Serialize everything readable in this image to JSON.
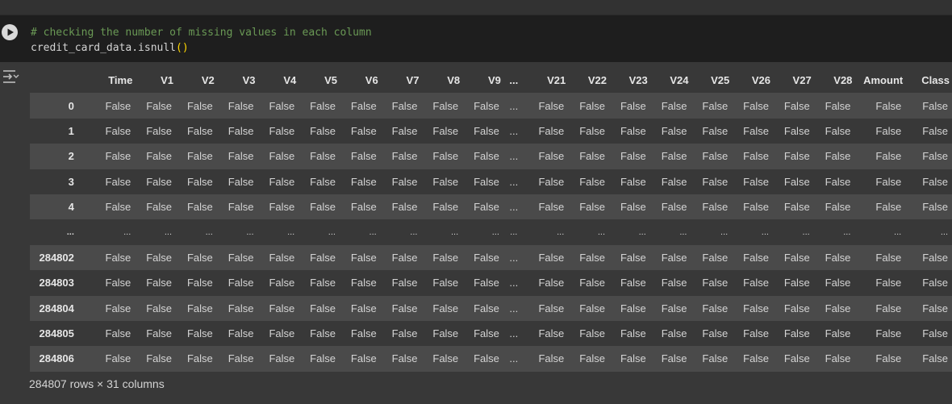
{
  "code_cell": {
    "comment": "# checking the number of missing values in each column",
    "code_prefix": "credit_card_data.isnull",
    "code_parens": "()"
  },
  "icons": {
    "run": "play-circle-icon",
    "output_toggle": "output-toggle-icon"
  },
  "table": {
    "header_index": "",
    "headers": [
      "Time",
      "V1",
      "V2",
      "V3",
      "V4",
      "V5",
      "V6",
      "V7",
      "V8",
      "V9",
      "...",
      "V21",
      "V22",
      "V23",
      "V24",
      "V25",
      "V26",
      "V27",
      "V28",
      "Amount",
      "Class"
    ],
    "rows": [
      {
        "index": "0",
        "cells": [
          "False",
          "False",
          "False",
          "False",
          "False",
          "False",
          "False",
          "False",
          "False",
          "False",
          "...",
          "False",
          "False",
          "False",
          "False",
          "False",
          "False",
          "False",
          "False",
          "False",
          "False"
        ]
      },
      {
        "index": "1",
        "cells": [
          "False",
          "False",
          "False",
          "False",
          "False",
          "False",
          "False",
          "False",
          "False",
          "False",
          "...",
          "False",
          "False",
          "False",
          "False",
          "False",
          "False",
          "False",
          "False",
          "False",
          "False"
        ]
      },
      {
        "index": "2",
        "cells": [
          "False",
          "False",
          "False",
          "False",
          "False",
          "False",
          "False",
          "False",
          "False",
          "False",
          "...",
          "False",
          "False",
          "False",
          "False",
          "False",
          "False",
          "False",
          "False",
          "False",
          "False"
        ]
      },
      {
        "index": "3",
        "cells": [
          "False",
          "False",
          "False",
          "False",
          "False",
          "False",
          "False",
          "False",
          "False",
          "False",
          "...",
          "False",
          "False",
          "False",
          "False",
          "False",
          "False",
          "False",
          "False",
          "False",
          "False"
        ]
      },
      {
        "index": "4",
        "cells": [
          "False",
          "False",
          "False",
          "False",
          "False",
          "False",
          "False",
          "False",
          "False",
          "False",
          "...",
          "False",
          "False",
          "False",
          "False",
          "False",
          "False",
          "False",
          "False",
          "False",
          "False"
        ]
      },
      {
        "index": "...",
        "cells": [
          "...",
          "...",
          "...",
          "...",
          "...",
          "...",
          "...",
          "...",
          "...",
          "...",
          "...",
          "...",
          "...",
          "...",
          "...",
          "...",
          "...",
          "...",
          "...",
          "...",
          "..."
        ]
      },
      {
        "index": "284802",
        "cells": [
          "False",
          "False",
          "False",
          "False",
          "False",
          "False",
          "False",
          "False",
          "False",
          "False",
          "...",
          "False",
          "False",
          "False",
          "False",
          "False",
          "False",
          "False",
          "False",
          "False",
          "False"
        ]
      },
      {
        "index": "284803",
        "cells": [
          "False",
          "False",
          "False",
          "False",
          "False",
          "False",
          "False",
          "False",
          "False",
          "False",
          "...",
          "False",
          "False",
          "False",
          "False",
          "False",
          "False",
          "False",
          "False",
          "False",
          "False"
        ]
      },
      {
        "index": "284804",
        "cells": [
          "False",
          "False",
          "False",
          "False",
          "False",
          "False",
          "False",
          "False",
          "False",
          "False",
          "...",
          "False",
          "False",
          "False",
          "False",
          "False",
          "False",
          "False",
          "False",
          "False",
          "False"
        ]
      },
      {
        "index": "284805",
        "cells": [
          "False",
          "False",
          "False",
          "False",
          "False",
          "False",
          "False",
          "False",
          "False",
          "False",
          "...",
          "False",
          "False",
          "False",
          "False",
          "False",
          "False",
          "False",
          "False",
          "False",
          "False"
        ]
      },
      {
        "index": "284806",
        "cells": [
          "False",
          "False",
          "False",
          "False",
          "False",
          "False",
          "False",
          "False",
          "False",
          "False",
          "...",
          "False",
          "False",
          "False",
          "False",
          "False",
          "False",
          "False",
          "False",
          "False",
          "False"
        ]
      }
    ]
  },
  "shape_text": "284807 rows × 31 columns",
  "colors": {
    "background": "#383838",
    "code_background": "#1e1e1e",
    "comment": "#6a9955",
    "row_stripe": "#4a4a4a"
  }
}
